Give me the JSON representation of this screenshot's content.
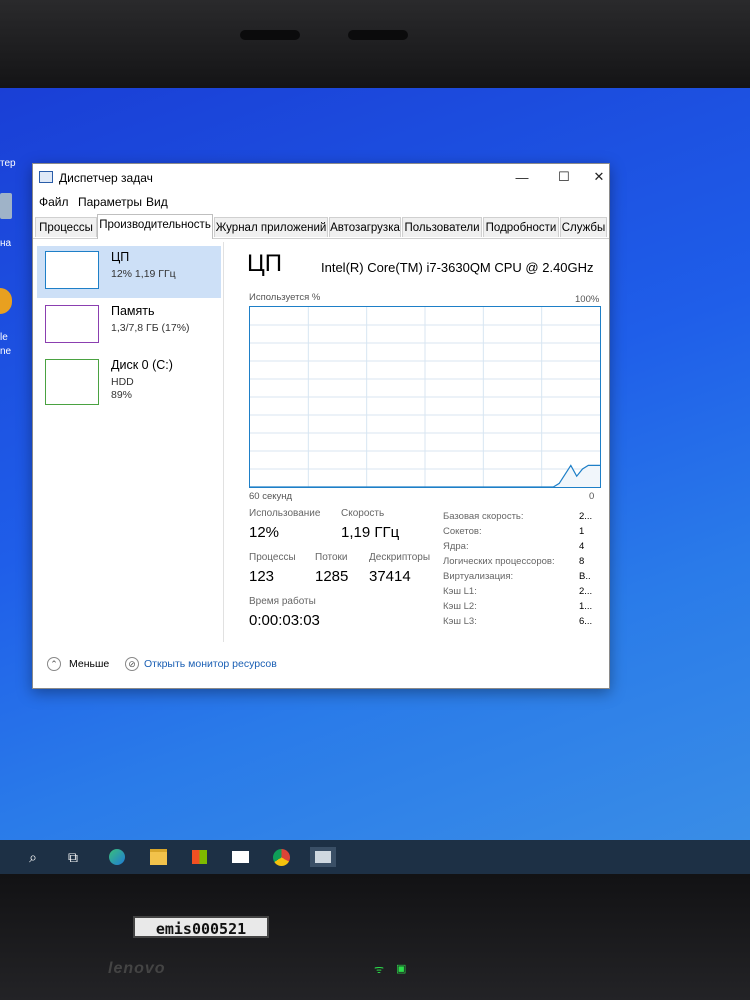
{
  "desktop": {
    "labels": [
      "тер",
      "на",
      "le",
      "ne"
    ]
  },
  "window": {
    "title": "Диспетчер задач",
    "controls": {
      "minimize": "—",
      "maximize": "☐",
      "close": "✕"
    }
  },
  "menu": [
    "Файл",
    "Параметры",
    "Вид"
  ],
  "tabs": [
    "Процессы",
    "Производительность",
    "Журнал приложений",
    "Автозагрузка",
    "Пользователи",
    "Подробности",
    "Службы"
  ],
  "active_tab": "Производительность",
  "sidebar": {
    "items": [
      {
        "name": "ЦП",
        "line1": "12% 1,19 ГГц",
        "line2": ""
      },
      {
        "name": "Память",
        "line1": "1,3/7,8 ГБ (17%)",
        "line2": ""
      },
      {
        "name": "Диск 0 (C:)",
        "line1": "HDD",
        "line2": "89%"
      }
    ]
  },
  "cpu": {
    "title": "ЦП",
    "model": "Intel(R) Core(TM) i7-3630QM CPU @ 2.40GHz",
    "graph_label": "Используется %",
    "graph_max": "100%",
    "graph_time": "60 секунд",
    "graph_min": "0",
    "graph_series_percent": [
      0,
      0,
      0,
      0,
      0,
      0,
      0,
      0,
      0,
      0,
      0,
      0,
      0,
      0,
      0,
      0,
      0,
      0,
      0,
      0,
      0,
      0,
      0,
      0,
      0,
      0,
      0,
      0,
      0,
      0,
      0,
      0,
      0,
      0,
      0,
      0,
      0,
      0,
      0,
      0,
      0,
      0,
      0,
      0,
      0,
      0,
      0,
      0,
      0,
      0,
      0,
      0,
      0,
      2,
      7,
      12,
      6,
      10,
      12,
      12,
      12
    ],
    "stats": {
      "usage_label": "Использование",
      "usage_value": "12%",
      "speed_label": "Скорость",
      "speed_value": "1,19 ГГц",
      "processes_label": "Процессы",
      "processes_value": "123",
      "threads_label": "Потоки",
      "threads_value": "1285",
      "handles_label": "Дескрипторы",
      "handles_value": "37414",
      "uptime_label": "Время работы",
      "uptime_value": "0:00:03:03"
    },
    "properties": [
      {
        "label": "Базовая скорость:",
        "value": "2..."
      },
      {
        "label": "Сокетов:",
        "value": "1"
      },
      {
        "label": "Ядра:",
        "value": "4"
      },
      {
        "label": "Логических процессоров:",
        "value": "8"
      },
      {
        "label": "Виртуализация:",
        "value": "В.."
      },
      {
        "label": "Кэш L1:",
        "value": "2..."
      },
      {
        "label": "Кэш L2:",
        "value": "1..."
      },
      {
        "label": "Кэш L3:",
        "value": "6..."
      }
    ]
  },
  "footer": {
    "less": "Меньше",
    "resource_monitor": "Открыть монитор ресурсов"
  },
  "bezel": {
    "asset_tag": "emis000521",
    "brand": "lenovo"
  },
  "colors": {
    "accent": "#1e7fc7",
    "sidebar_selected": "#cde0f7",
    "memory": "#8b3fb0",
    "disk": "#4aa241",
    "desktop_blue": "#1f5ee9",
    "taskbar": "#1d3045"
  },
  "icons": {
    "taskbar": [
      "search-icon",
      "task-view-icon",
      "edge-icon",
      "file-explorer-icon",
      "store-icon",
      "mail-icon",
      "chrome-icon",
      "task-manager-icon"
    ]
  }
}
